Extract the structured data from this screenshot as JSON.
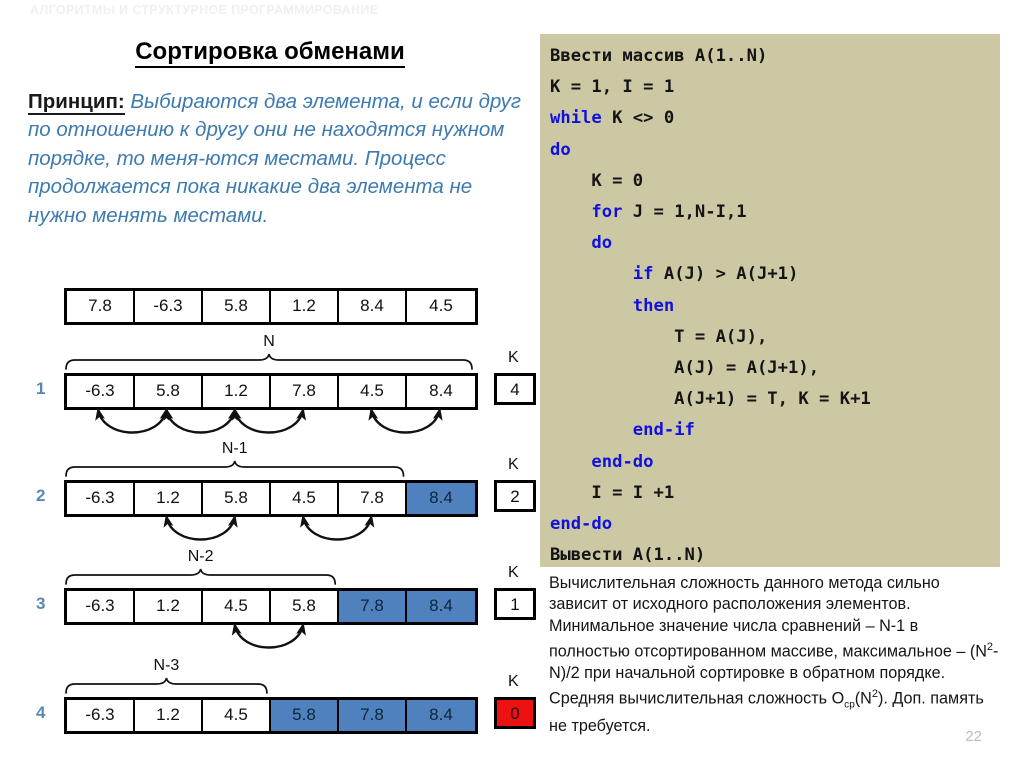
{
  "header": {
    "kicker": "АЛГОРИТМЫ И СТРУКТУРНОЕ ПРОГРАММИРОВАНИЕ"
  },
  "slide": {
    "title": "Сортировка обменами",
    "principle_label": "Принцип:",
    "principle_text": "Выбираются два элемента, и если друг по отношению к другу они не находятся  нужном порядке, то меня-ются местами. Процесс продолжается пока никакие два элемента не нужно менять местами.",
    "page_number": "22"
  },
  "diagram": {
    "k_label": "K",
    "initial": {
      "values": [
        "7.8",
        "-6.3",
        "5.8",
        "1.2",
        "8.4",
        "4.5"
      ],
      "sorted_from": 6
    },
    "passes": [
      {
        "step": "1",
        "span_label": "N",
        "values": [
          "-6.3",
          "5.8",
          "1.2",
          "7.8",
          "4.5",
          "8.4"
        ],
        "sorted_from": 6,
        "k": "4",
        "k_zero": false,
        "swaps": [
          [
            0,
            1
          ],
          [
            1,
            2
          ],
          [
            2,
            3
          ],
          [
            4,
            5
          ]
        ]
      },
      {
        "step": "2",
        "span_label": "N-1",
        "values": [
          "-6.3",
          "1.2",
          "5.8",
          "4.5",
          "7.8",
          "8.4"
        ],
        "sorted_from": 5,
        "k": "2",
        "k_zero": false,
        "swaps": [
          [
            1,
            2
          ],
          [
            3,
            4
          ]
        ]
      },
      {
        "step": "3",
        "span_label": "N-2",
        "values": [
          "-6.3",
          "1.2",
          "4.5",
          "5.8",
          "7.8",
          "8.4"
        ],
        "sorted_from": 4,
        "k": "1",
        "k_zero": false,
        "swaps": [
          [
            2,
            3
          ]
        ]
      },
      {
        "step": "4",
        "span_label": "N-3",
        "values": [
          "-6.3",
          "1.2",
          "4.5",
          "5.8",
          "7.8",
          "8.4"
        ],
        "sorted_from": 3,
        "k": "0",
        "k_zero": true,
        "swaps": []
      }
    ]
  },
  "code": {
    "lines": [
      [
        {
          "t": "Ввести массив A(1..N)",
          "k": false
        }
      ],
      [
        {
          "t": "K = 1, I = 1",
          "k": false
        }
      ],
      [
        {
          "t": "while",
          "k": true
        },
        {
          "t": " K <> 0",
          "k": false
        }
      ],
      [
        {
          "t": "do",
          "k": true
        }
      ],
      [
        {
          "t": "    K = 0",
          "k": false
        }
      ],
      [
        {
          "t": "    ",
          "k": false
        },
        {
          "t": "for",
          "k": true
        },
        {
          "t": " J = 1,N-I,1",
          "k": false
        }
      ],
      [
        {
          "t": "    ",
          "k": false
        },
        {
          "t": "do",
          "k": true
        }
      ],
      [
        {
          "t": "        ",
          "k": false
        },
        {
          "t": "if",
          "k": true
        },
        {
          "t": " A(J) > A(J+1)",
          "k": false
        }
      ],
      [
        {
          "t": "        ",
          "k": false
        },
        {
          "t": "then",
          "k": true
        }
      ],
      [
        {
          "t": "            T = A(J),",
          "k": false
        }
      ],
      [
        {
          "t": "            A(J) = A(J+1),",
          "k": false
        }
      ],
      [
        {
          "t": "            A(J+1) = T, K = K+1",
          "k": false
        }
      ],
      [
        {
          "t": "        ",
          "k": false
        },
        {
          "t": "end-if",
          "k": true
        }
      ],
      [
        {
          "t": "    ",
          "k": false
        },
        {
          "t": "end-do",
          "k": true
        }
      ],
      [
        {
          "t": "    I = I +1",
          "k": false
        }
      ],
      [
        {
          "t": "end-do",
          "k": true
        }
      ],
      [
        {
          "t": "Вывести A(1..N)",
          "k": false
        }
      ]
    ]
  },
  "note": {
    "html": "Вычислительная сложность данного метода сильно зависит от исходного расположения элементов. Минимальное значение числа сравнений – N-1 в полностью отсортированном массиве, максимальное – (N<sup>2</sup>-N)/2 при начальной сортировке в обратном порядке. Средняя вычислительная сложность O<sub>ср</sub>(N<sup>2</sup>). Доп. память не требуется."
  },
  "colors": {
    "sorted_cell": "#4e81bd",
    "k_zero_cell": "#ee1111",
    "code_panel": "#cdc8a4",
    "accent_text": "#31678f",
    "row_number": "#5b87b5"
  }
}
